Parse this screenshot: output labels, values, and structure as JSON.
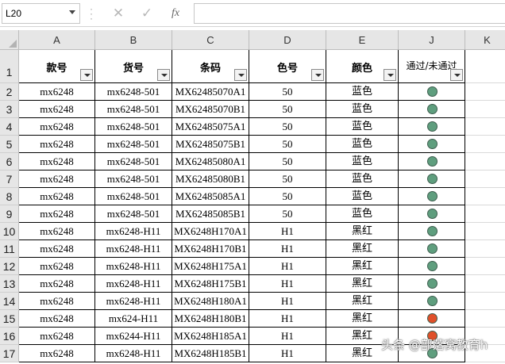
{
  "formula_bar": {
    "name_box": "L20",
    "cancel_icon": "✕",
    "enter_icon": "✓",
    "function_icon": "fx",
    "formula_value": ""
  },
  "columns": [
    "A",
    "B",
    "C",
    "D",
    "E",
    "J",
    "K"
  ],
  "table_headers": [
    "款号",
    "货号",
    "条码",
    "色号",
    "颜色",
    "通过/未通过"
  ],
  "rows": [
    {
      "num": "1"
    },
    {
      "num": "2",
      "cells": [
        "mx6248",
        "mx6248-501",
        "MX62485070A1",
        "50",
        "蓝色"
      ],
      "status": "pass"
    },
    {
      "num": "3",
      "cells": [
        "mx6248",
        "mx6248-501",
        "MX62485070B1",
        "50",
        "蓝色"
      ],
      "status": "pass"
    },
    {
      "num": "4",
      "cells": [
        "mx6248",
        "mx6248-501",
        "MX62485075A1",
        "50",
        "蓝色"
      ],
      "status": "pass"
    },
    {
      "num": "5",
      "cells": [
        "mx6248",
        "mx6248-501",
        "MX62485075B1",
        "50",
        "蓝色"
      ],
      "status": "pass"
    },
    {
      "num": "6",
      "cells": [
        "mx6248",
        "mx6248-501",
        "MX62485080A1",
        "50",
        "蓝色"
      ],
      "status": "pass"
    },
    {
      "num": "7",
      "cells": [
        "mx6248",
        "mx6248-501",
        "MX62485080B1",
        "50",
        "蓝色"
      ],
      "status": "pass"
    },
    {
      "num": "8",
      "cells": [
        "mx6248",
        "mx6248-501",
        "MX62485085A1",
        "50",
        "蓝色"
      ],
      "status": "pass"
    },
    {
      "num": "9",
      "cells": [
        "mx6248",
        "mx6248-501",
        "MX62485085B1",
        "50",
        "蓝色"
      ],
      "status": "pass"
    },
    {
      "num": "10",
      "cells": [
        "mx6248",
        "mx6248-H11",
        "MX6248H170A1",
        "H1",
        "黑红"
      ],
      "status": "pass"
    },
    {
      "num": "11",
      "cells": [
        "mx6248",
        "mx6248-H11",
        "MX6248H170B1",
        "H1",
        "黑红"
      ],
      "status": "pass"
    },
    {
      "num": "12",
      "cells": [
        "mx6248",
        "mx6248-H11",
        "MX6248H175A1",
        "H1",
        "黑红"
      ],
      "status": "pass"
    },
    {
      "num": "13",
      "cells": [
        "mx6248",
        "mx6248-H11",
        "MX6248H175B1",
        "H1",
        "黑红"
      ],
      "status": "pass"
    },
    {
      "num": "14",
      "cells": [
        "mx6248",
        "mx6248-H11",
        "MX6248H180A1",
        "H1",
        "黑红"
      ],
      "status": "pass"
    },
    {
      "num": "15",
      "cells": [
        "mx6248",
        "mx624-H11",
        "MX6248H180B1",
        "H1",
        "黑红"
      ],
      "status": "fail"
    },
    {
      "num": "16",
      "cells": [
        "mx6248",
        "mx6244-H11",
        "MX6248H185A1",
        "H1",
        "黑红"
      ],
      "status": "fail"
    },
    {
      "num": "17",
      "cells": [
        "mx6248",
        "mx6248-H11",
        "MX6248H185B1",
        "H1",
        "黑红"
      ],
      "status": "pass"
    }
  ],
  "status_colors": {
    "pass": "#5f9e7e",
    "fail": "#e0502a"
  },
  "watermark": "头条 @部落窝教育h"
}
